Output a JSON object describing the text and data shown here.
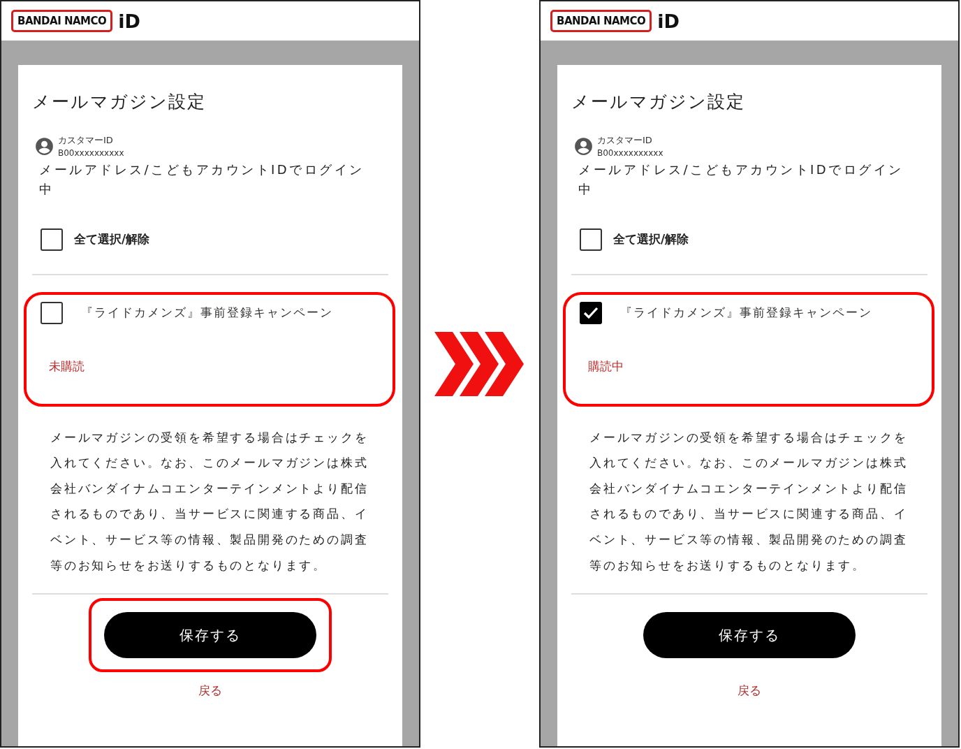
{
  "panels": [
    {
      "logo": {
        "brand": "BANDAI NAMCO",
        "suffix": "iD"
      },
      "title": "メールマガジン設定",
      "customer_id_label": "カスタマーID",
      "customer_id": "B00xxxxxxxxxx",
      "login_note": "メールアドレス/こどもアカウントIDでログイン中",
      "select_all": {
        "label": "全て選択/解除",
        "checked": false
      },
      "campaigns": [
        {
          "name": "『ライドカメンズ』事前登録キャンペーン",
          "checked": false,
          "status": "未購読",
          "highlighted": true
        }
      ],
      "description": "メールマガジンの受領を希望する場合はチェックを入れてください。なお、このメールマガジンは株式会社バンダイナムコエンターテインメントより配信されるものであり、当サービスに関連する商品、イベント、サービス等の情報、製品開発のための調査等のお知らせをお送りするものとなります。",
      "save_button": {
        "label": "保存する",
        "highlighted": true
      },
      "back_link": "戻る"
    },
    {
      "logo": {
        "brand": "BANDAI NAMCO",
        "suffix": "iD"
      },
      "title": "メールマガジン設定",
      "customer_id_label": "カスタマーID",
      "customer_id": "B00xxxxxxxxxx",
      "login_note": "メールアドレス/こどもアカウントIDでログイン中",
      "select_all": {
        "label": "全て選択/解除",
        "checked": false
      },
      "campaigns": [
        {
          "name": "『ライドカメンズ』事前登録キャンペーン",
          "checked": true,
          "status": "購読中",
          "highlighted": true
        }
      ],
      "description": "メールマガジンの受領を希望する場合はチェックを入れてください。なお、このメールマガジンは株式会社バンダイナムコエンターテインメントより配信されるものであり、当サービスに関連する商品、イベント、サービス等の情報、製品開発のための調査等のお知らせをお送りするものとなります。",
      "save_button": {
        "label": "保存する",
        "highlighted": false
      },
      "back_link": "戻る"
    }
  ]
}
